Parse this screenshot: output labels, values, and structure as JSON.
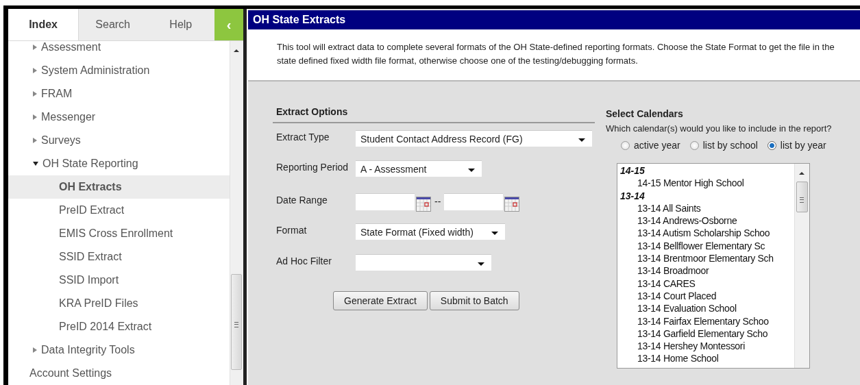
{
  "sidebar": {
    "tabs": [
      {
        "label": "Index",
        "selected": true
      },
      {
        "label": "Search",
        "selected": false
      },
      {
        "label": "Help",
        "selected": false
      }
    ],
    "collapse_button": "‹",
    "tree": [
      {
        "label": "Assessment",
        "expanded": false
      },
      {
        "label": "System Administration",
        "expanded": false
      },
      {
        "label": "FRAM",
        "expanded": false
      },
      {
        "label": "Messenger",
        "expanded": false
      },
      {
        "label": "Surveys",
        "expanded": false
      },
      {
        "label": "OH State Reporting",
        "expanded": true,
        "children": [
          {
            "label": "OH Extracts",
            "selected": true
          },
          {
            "label": "PreID Extract",
            "selected": false
          },
          {
            "label": "EMIS Cross Enrollment",
            "selected": false
          },
          {
            "label": "SSID Extract",
            "selected": false
          },
          {
            "label": "SSID Import",
            "selected": false
          },
          {
            "label": "KRA PreID Files",
            "selected": false
          },
          {
            "label": "PreID 2014 Extract",
            "selected": false
          }
        ]
      },
      {
        "label": "Data Integrity Tools",
        "expanded": false
      },
      {
        "label": "Account Settings",
        "kind": "leaf"
      }
    ]
  },
  "content": {
    "title": "OH State Extracts",
    "description": "This tool will extract data to complete several formats of the OH State-defined reporting formats. Choose the State Format to get the file in the state defined fixed width file format, otherwise choose one of the testing/debugging formats.",
    "extract_options": {
      "heading": "Extract Options",
      "fields": [
        {
          "kind": "select",
          "label": "Extract Type",
          "value": "Student Contact Address Record (FG)"
        },
        {
          "kind": "select",
          "label": "Reporting Period",
          "value": "A - Assessment"
        },
        {
          "kind": "daterange",
          "label": "Date Range",
          "separator": "--"
        },
        {
          "kind": "select",
          "label": "Format",
          "value": "State Format (Fixed width)"
        },
        {
          "kind": "select",
          "label": "Ad Hoc Filter"
        }
      ],
      "buttons": [
        "Generate Extract",
        "Submit to Batch"
      ]
    },
    "calendars": {
      "heading": "Select Calendars",
      "question": "Which calendar(s) would you like to include in the report?",
      "radios": [
        {
          "label": "active year",
          "selected": false
        },
        {
          "label": "list by school",
          "selected": false
        },
        {
          "label": "list by year",
          "selected": true
        }
      ],
      "list": [
        {
          "label": "14-15",
          "children": [
            "14-15 Mentor High School"
          ]
        },
        {
          "label": "13-14",
          "children": [
            "13-14 All Saints",
            "13-14 Andrews-Osborne",
            "13-14 Autism Scholarship Schoo",
            "13-14 Bellflower Elementary Sc",
            "13-14 Brentmoor Elementary Sch",
            "13-14 Broadmoor",
            "13-14 CARES",
            "13-14 Court Placed",
            "13-14 Evaluation School",
            "13-14 Fairfax Elementary Schoo",
            "13-14 Garfield Elementary Scho",
            "13-14 Hershey Montessori",
            "13-14 Home School"
          ]
        }
      ]
    }
  }
}
